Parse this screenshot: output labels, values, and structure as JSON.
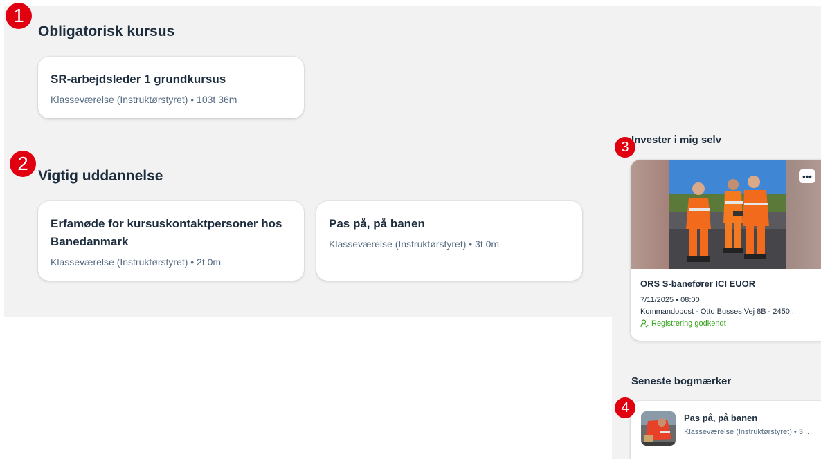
{
  "markers": [
    "1",
    "2",
    "3",
    "4"
  ],
  "required": {
    "title": "Obligatorisk kursus",
    "cards": [
      {
        "title": "SR-arbejdsleder 1 grundkursus",
        "meta": "Klasseværelse (Instruktørstyret) • 103t 36m"
      }
    ]
  },
  "important": {
    "title": "Vigtig uddannelse",
    "cards": [
      {
        "title": "Erfamøde for kursuskontaktpersoner hos Banedanmark",
        "meta": "Klasseværelse (Instruktørstyret) • 2t 0m"
      },
      {
        "title": "Pas på, på banen",
        "meta": "Klasseværelse (Instruktørstyret) • 3t 0m"
      }
    ]
  },
  "invest": {
    "title": "Invester i mig selv",
    "card": {
      "more_label": "•••",
      "more_icon": "more-options-icon",
      "title": "ORS S-banefører ICI EUOR",
      "datetime": "7/11/2025 • 08:00",
      "location": "Kommandopost - Otto Busses Vej 8B - 2450...",
      "status": "Registrering godkendt",
      "status_icon": "user-check-icon",
      "status_color": "#36a41d"
    }
  },
  "bookmarks": {
    "title": "Seneste bogmærker",
    "items": [
      {
        "title": "Pas på, på banen",
        "meta": "Klasseværelse (Instruktørstyret) • 3..."
      }
    ]
  },
  "colors": {
    "marker": "#e1000f",
    "panel_bg": "#f2f2f2",
    "text": "#1d2d3e",
    "meta": "#556b82"
  }
}
